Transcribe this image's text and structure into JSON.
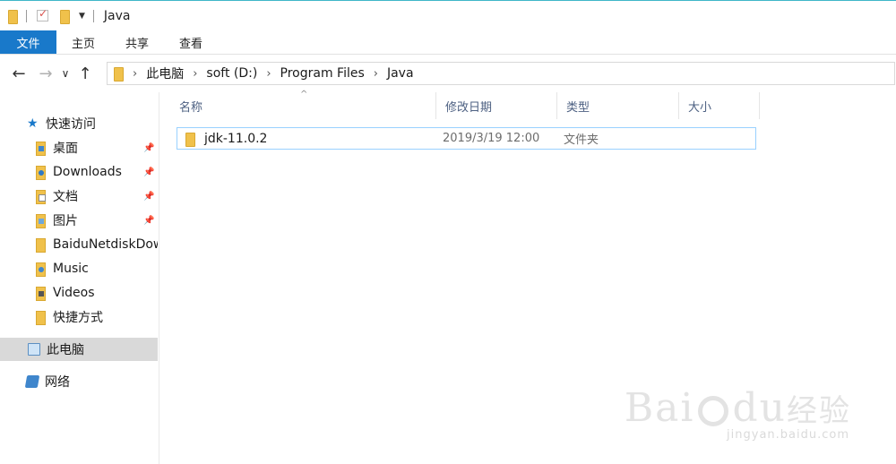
{
  "window": {
    "title": "Java"
  },
  "ribbon": {
    "tabs": [
      {
        "label": "文件",
        "active": true
      },
      {
        "label": "主页"
      },
      {
        "label": "共享"
      },
      {
        "label": "查看"
      }
    ]
  },
  "nav": {
    "back_icon": "←",
    "forward_icon": "→",
    "recent_icon": "∨",
    "up_icon": "↑",
    "breadcrumbs": [
      "此电脑",
      "soft (D:)",
      "Program Files",
      "Java"
    ],
    "separator": "›"
  },
  "sidebar": {
    "quick_access": "快速访问",
    "items": [
      {
        "label": "桌面",
        "pinned": true
      },
      {
        "label": "Downloads",
        "pinned": true
      },
      {
        "label": "文档",
        "pinned": true
      },
      {
        "label": "图片",
        "pinned": true
      },
      {
        "label": "BaiduNetdiskDow",
        "pinned": false
      },
      {
        "label": "Music",
        "pinned": false
      },
      {
        "label": "Videos",
        "pinned": false
      },
      {
        "label": "快捷方式",
        "pinned": false
      }
    ],
    "this_pc": "此电脑",
    "network": "网络"
  },
  "columns": [
    "名称",
    "修改日期",
    "类型",
    "大小"
  ],
  "files": [
    {
      "name": "jdk-11.0.2",
      "modified": "2019/3/19 12:00",
      "type": "文件夹",
      "size": ""
    }
  ],
  "watermark": {
    "main": "Bai",
    "main2": "du",
    "cn": "经验",
    "url": "jingyan.baidu.com"
  },
  "colors": {
    "accent": "#1979ca",
    "selection_border": "#99d1ff",
    "folder": "#f0c14b"
  }
}
